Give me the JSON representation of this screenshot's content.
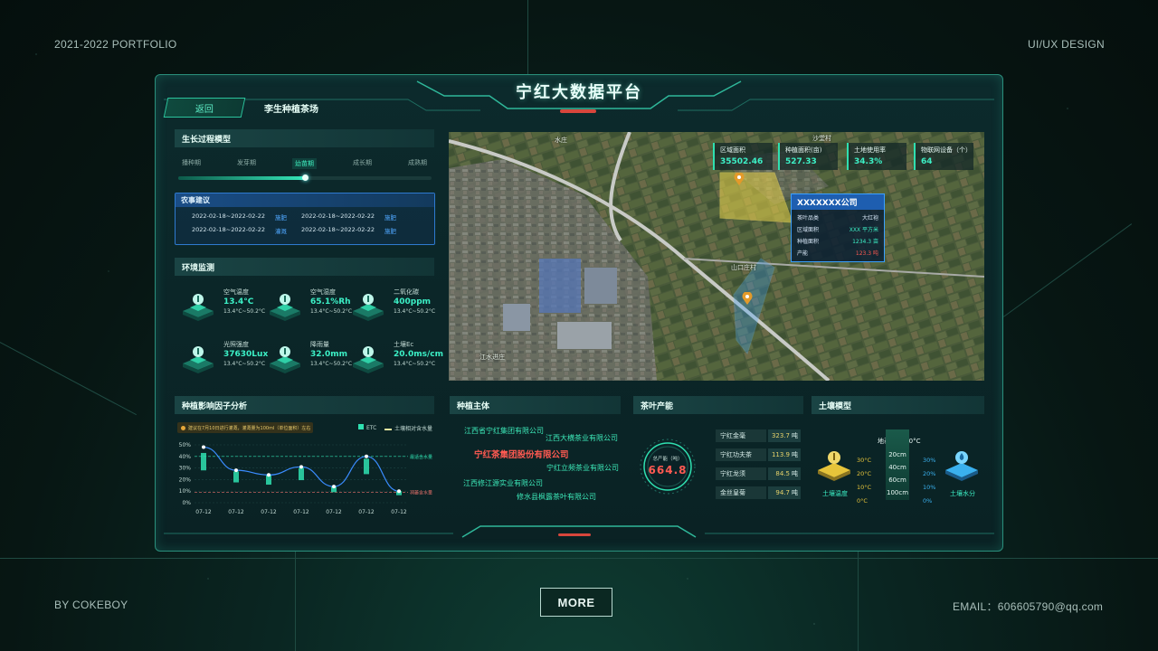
{
  "portfolio": {
    "top_left": "2021-2022 PORTFOLIO",
    "top_right": "UI/UX DESIGN",
    "bottom_left": "BY COKEBOY",
    "bottom_right": "EMAIL：606605790@qq.com",
    "more_label": "MORE"
  },
  "app": {
    "title": "宁红大数据平台",
    "back_label": "返回",
    "site_tab": "李生种植茶场"
  },
  "growth": {
    "title": "生长过程模型",
    "stages": [
      "播种期",
      "发芽期",
      "幼苗期",
      "成长期",
      "成熟期"
    ],
    "active_stage_index": 2,
    "progress": 0.5
  },
  "advice": {
    "title": "农事建议",
    "rows": [
      {
        "date1": "2022-02-18~2022-02-22",
        "act1": "施肥",
        "date2": "2022-02-18~2022-02-22",
        "act2": "施肥"
      },
      {
        "date1": "2022-02-18~2022-02-22",
        "act1": "灌溉",
        "date2": "2022-02-18~2022-02-22",
        "act2": "施肥"
      }
    ]
  },
  "environment": {
    "title": "环境监测",
    "items": [
      {
        "name": "空气温度",
        "value": "13.4°C",
        "range": "13.4°C~50.2°C",
        "icon": "thermometer-icon"
      },
      {
        "name": "空气湿度",
        "value": "65.1%Rh",
        "range": "13.4°C~50.2°C",
        "icon": "humidity-thermometer-icon"
      },
      {
        "name": "二氧化碳",
        "value": "400ppm",
        "range": "13.4°C~50.2°C",
        "icon": "co2-cloud-icon"
      },
      {
        "name": "光照强度",
        "value": "37630Lux",
        "range": "13.4°C~50.2°C",
        "icon": "sun-icon"
      },
      {
        "name": "降雨量",
        "value": "32.0mm",
        "range": "13.4°C~50.2°C",
        "icon": "rain-cloud-icon"
      },
      {
        "name": "土壤Ec",
        "value": "20.0ms/cm",
        "range": "13.4°C~50.2°C",
        "icon": "soil-ec-icon"
      }
    ]
  },
  "map": {
    "stats": [
      {
        "label": "区域面积",
        "value": "35502.46"
      },
      {
        "label": "种植面积(亩)",
        "value": "527.33"
      },
      {
        "label": "土地使用率",
        "value": "34.3%"
      },
      {
        "label": "物联网设备（个）",
        "value": "64"
      }
    ],
    "popup": {
      "title": "XXXXXXX公司",
      "rows": [
        {
          "label": "茶叶品类",
          "value": "大红袍"
        },
        {
          "label": "区域面积",
          "value": "XXX 平方米"
        },
        {
          "label": "种植面积",
          "value": "1234.3 亩"
        },
        {
          "label": "产能",
          "value": "123.3 吨"
        }
      ]
    },
    "labels": [
      "沙堂村",
      "山口庄村",
      "江水进庄",
      "水庄"
    ]
  },
  "factor_chart": {
    "title": "种植影响因子分析",
    "notice": "建议在7月10日进行灌溉，灌溉量为100ml（单位面积）左右",
    "legend_etc": "ETC",
    "legend_soil": "土壤相对含水量",
    "upper_label": "最适含水量",
    "lower_label": "凋萎含水量"
  },
  "chart_data": {
    "type": "bar",
    "categories": [
      "07-12",
      "07-12",
      "07-12",
      "07-12",
      "07-12",
      "07-12",
      "07-12"
    ],
    "yticks": [
      "50%",
      "40%",
      "30%",
      "20%",
      "10%",
      "0%"
    ],
    "ylim": [
      0,
      50
    ],
    "series": [
      {
        "name": "ETC",
        "values": [
          43,
          27,
          24,
          30,
          14,
          38,
          10
        ]
      },
      {
        "name": "土壤相对含水量",
        "type": "line",
        "values": [
          48,
          28,
          24,
          31,
          14,
          40,
          10
        ]
      }
    ],
    "reference_lines": [
      40,
      9
    ]
  },
  "entities": {
    "title": "种植主体",
    "items": [
      {
        "name": "江西省宁红集团有限公司",
        "highlight": false
      },
      {
        "name": "江西大横茶业有限公司",
        "highlight": false
      },
      {
        "name": "宁红茶集团股份有限公司",
        "highlight": true
      },
      {
        "name": "宁红立频茶业有限公司",
        "highlight": false
      },
      {
        "name": "江西修江源实业有限公司",
        "highlight": false
      },
      {
        "name": "修水县枫露茶叶有限公司",
        "highlight": false
      }
    ]
  },
  "tea": {
    "title": "茶叶产能",
    "total_label": "总产能（吨）",
    "total_value": "664.8",
    "unit": "吨",
    "items": [
      {
        "name": "宁红金毫",
        "value": "323.7"
      },
      {
        "name": "宁红功夫茶",
        "value": "113.9"
      },
      {
        "name": "宁红龙须",
        "value": "84.5"
      },
      {
        "name": "金丝皇菊",
        "value": "94.7"
      }
    ]
  },
  "soil": {
    "title": "土壤模型",
    "surface": "地表温度 30°C",
    "depths": [
      "20cm",
      "40cm",
      "60cm",
      "100cm"
    ],
    "temps": [
      "30°C",
      "20°C",
      "10°C",
      "0°C"
    ],
    "moisture": [
      "30%",
      "20%",
      "10%",
      "0%"
    ],
    "temp_label": "土壤温度",
    "moisture_label": "土壤水分"
  },
  "colors": {
    "accent": "#3cf0c6",
    "highlight": "#ff5a52",
    "gold": "#e6d26a",
    "blue": "#3aa0ff"
  }
}
